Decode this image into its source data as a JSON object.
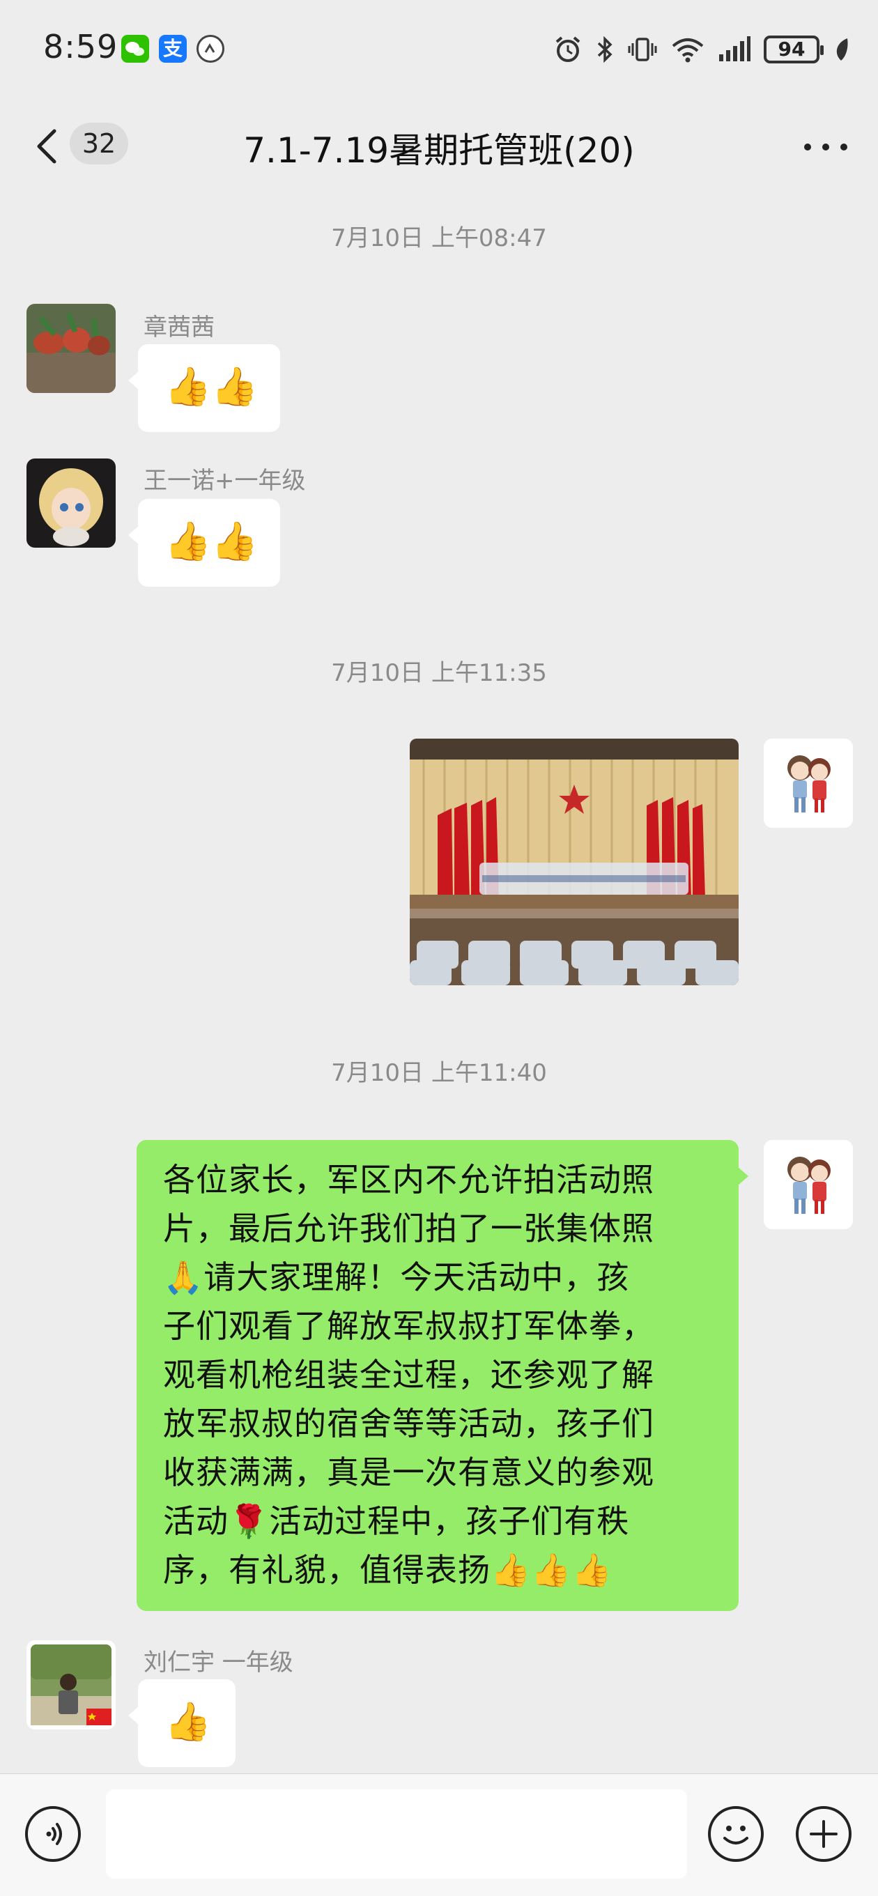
{
  "status_bar": {
    "time": "8:59",
    "apps": [
      {
        "icon": "wechat-icon",
        "label": "",
        "color": "#2dc100"
      },
      {
        "icon": "alipay-icon",
        "label": "支",
        "color": "#1677ff"
      },
      {
        "icon": "speed-icon",
        "label": "",
        "color": "#555555"
      }
    ],
    "icons": [
      "alarm-icon",
      "bluetooth-icon",
      "vibrate-icon",
      "wifi-icon",
      "signal-icon"
    ],
    "battery": "94"
  },
  "nav": {
    "unread_count": "32",
    "title": "7.1-7.19暑期托管班(20)"
  },
  "messages": {
    "ts1": "7月10日 上午08:47",
    "m1_sender": "章茜茜",
    "m1_content": "👍👍",
    "m2_sender": "王一诺+一年级",
    "m2_content": "👍👍",
    "ts2": "7月10日 上午11:35",
    "ts3": "7月10日 上午11:40",
    "m4_content": "各位家长，军区内不允许拍活动照\n片，最后允许我们拍了一张集体照\n🙏请大家理解！今天活动中，孩\n子们观看了解放军叔叔打军体拳，\n观看机枪组装全过程，还参观了解\n放军叔叔的宿舍等等活动，孩子们\n收获满满，真是一次有意义的参观\n活动🌹活动过程中，孩子们有秩\n序，有礼貌，值得表扬👍👍👍",
    "m5_sender": "刘仁宇 一年级",
    "m5_content": "👍"
  },
  "input": {
    "placeholder": ""
  },
  "colors": {
    "background": "#ededed",
    "bubble_mine": "#95ec69",
    "bubble_other": "#ffffff"
  }
}
